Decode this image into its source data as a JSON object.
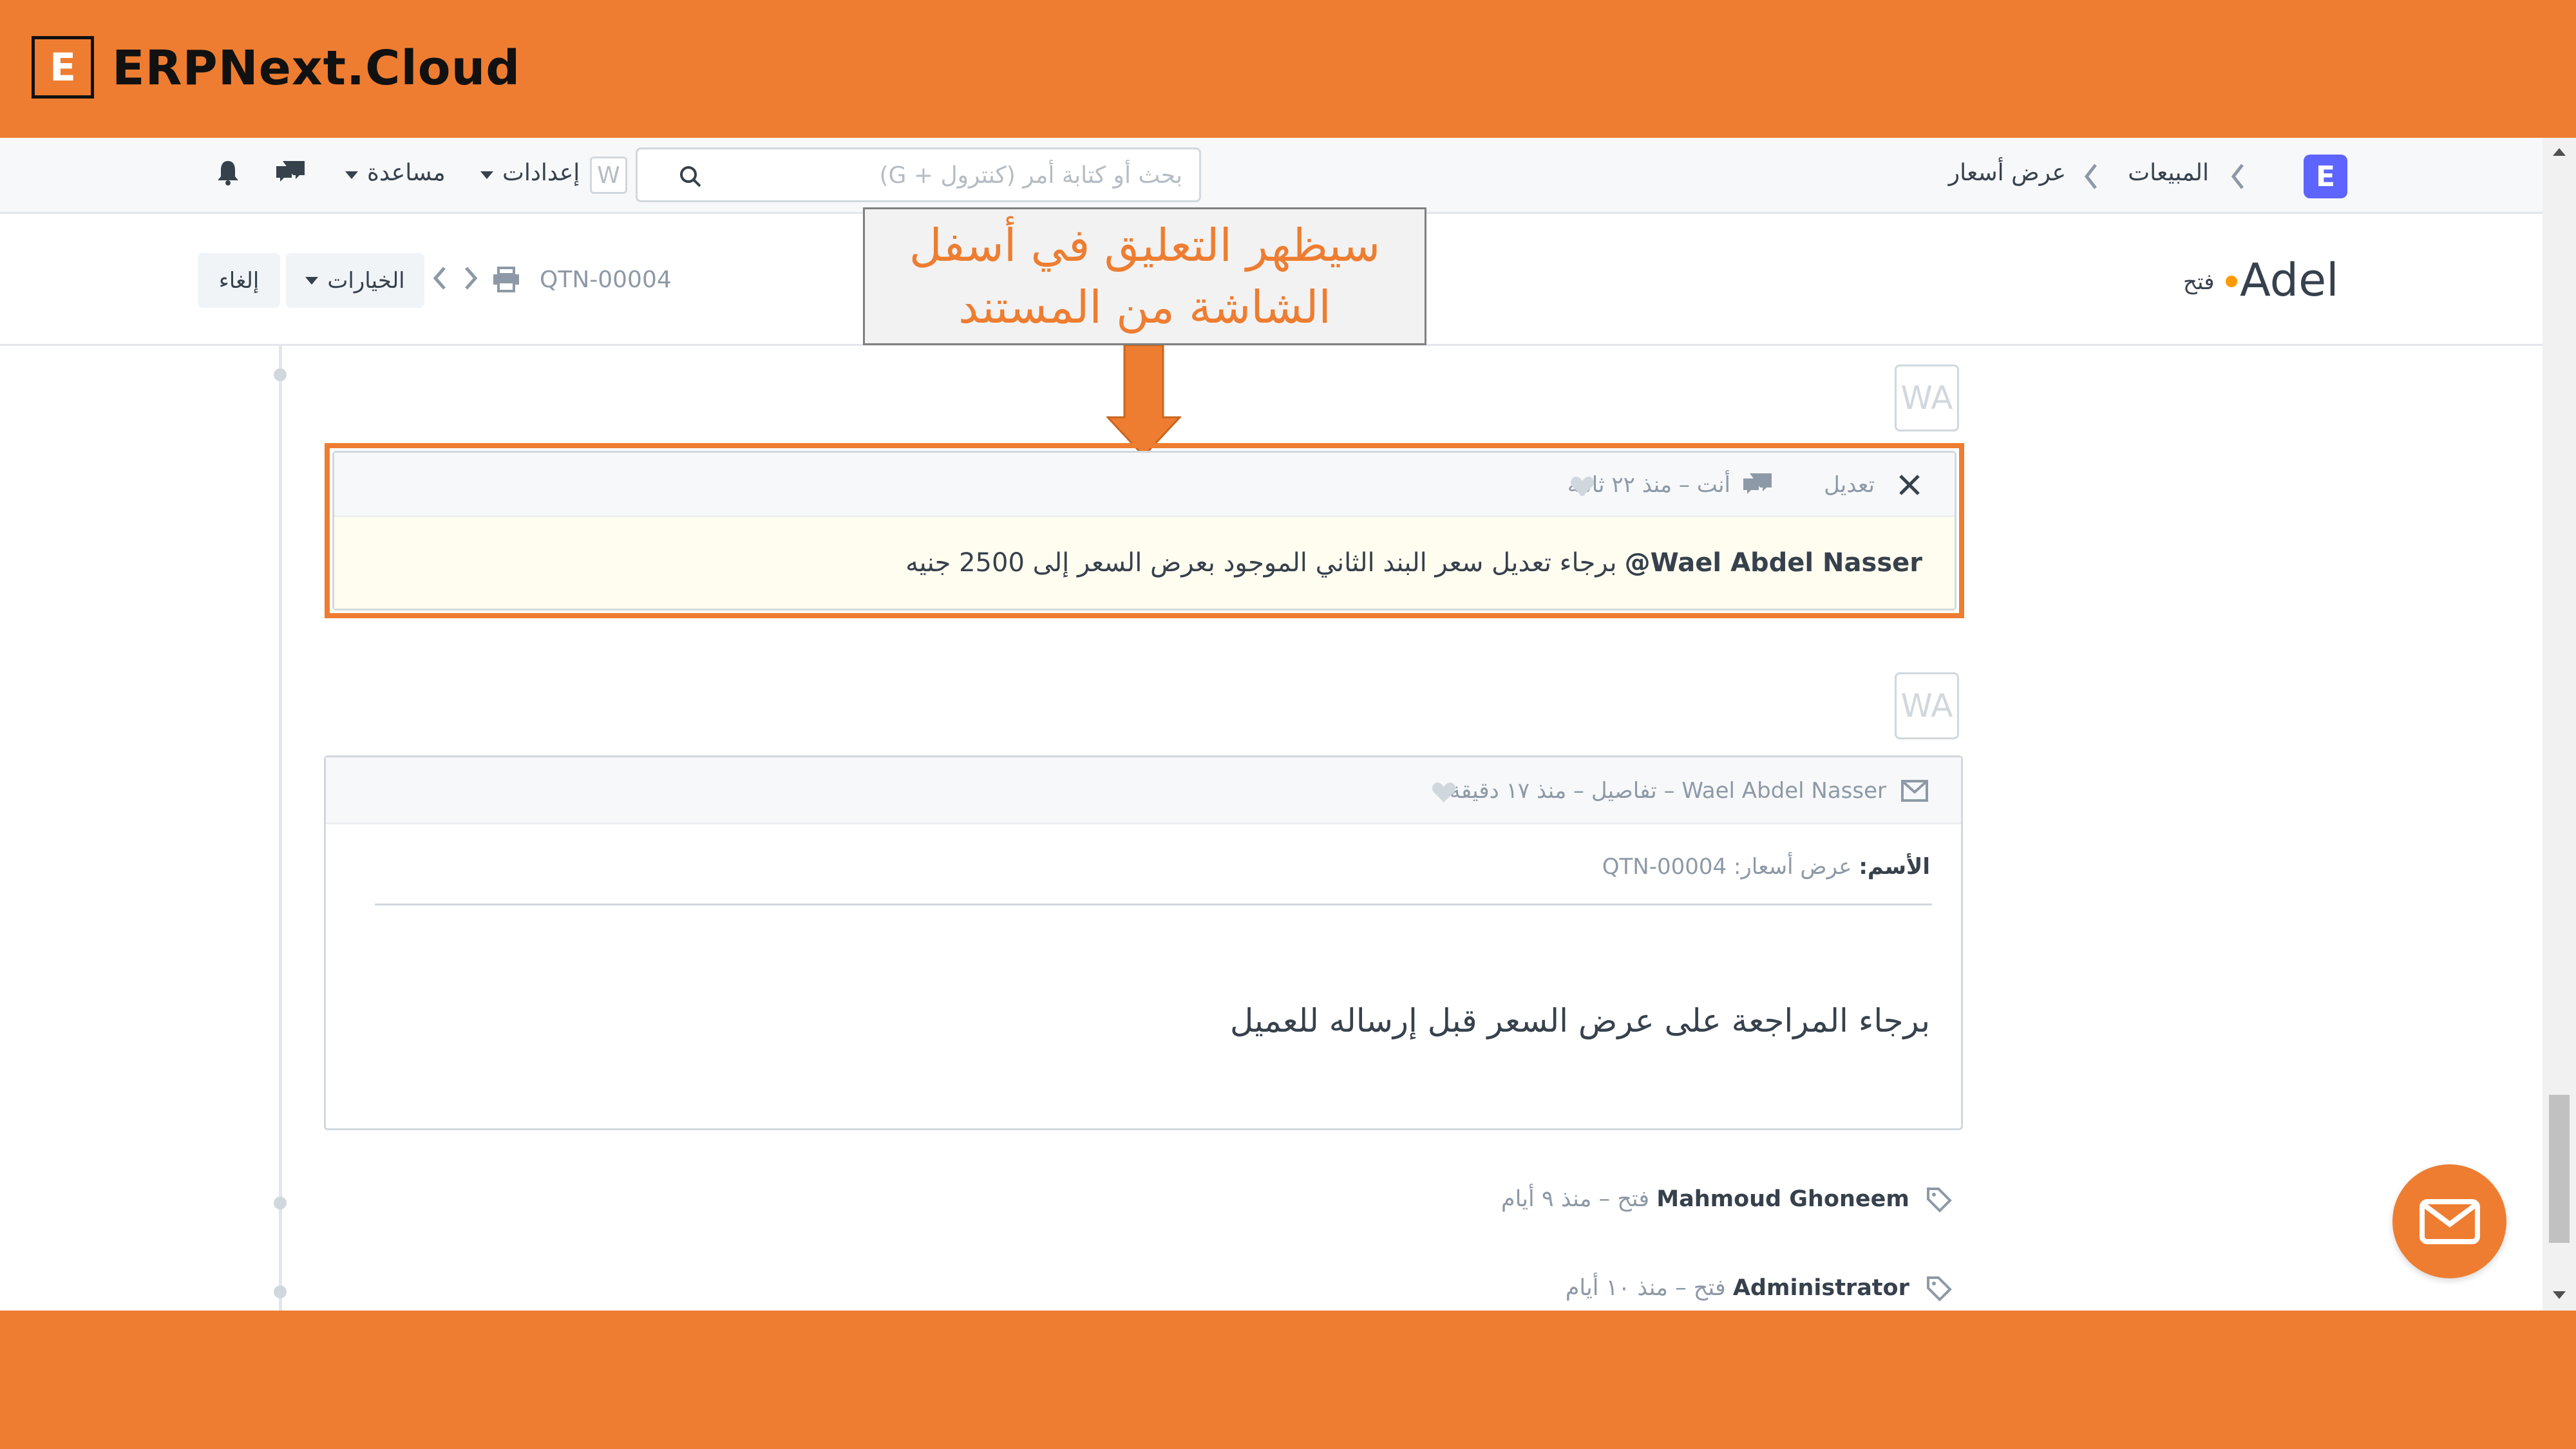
{
  "brand": {
    "logo_letter": "E",
    "name": "ERPNext.Cloud"
  },
  "navbar": {
    "app_badge": "E",
    "breadcrumb": [
      "المبيعات",
      "عرض أسعار"
    ],
    "search_placeholder": "بحث أو كتابة أمر (كنترول + G)",
    "settings_label": "إعدادات",
    "settings_badge": "W",
    "help_label": "مساعدة"
  },
  "page": {
    "title": "Adel",
    "status": "فتح",
    "doc_id": "QTN-00004",
    "options_label": "الخيارات",
    "cancel_label": "إلغاء"
  },
  "annotation": {
    "line1": "سيظهر التعليق في أسفل",
    "line2": "الشاشة من المستند"
  },
  "timeline": {
    "comment": {
      "avatar": "WA",
      "edit_label": "تعديل",
      "meta": "أنت – منذ ٢٢ ثانية",
      "mention": "@Wael Abdel Nasser",
      "body": "برجاء تعديل سعر البند الثاني الموجود بعرض السعر إلى 2500 جنيه"
    },
    "email": {
      "avatar": "WA",
      "meta": "Wael Abdel Nasser – تفاصيل – منذ ١٧ دقيقة",
      "subject_label": "الأسم:",
      "subject_value": "عرض أسعار: QTN-00004",
      "body": "برجاء المراجعة على عرض السعر قبل إرساله للعميل"
    },
    "activity": [
      {
        "user": "Mahmoud Ghoneem",
        "text": "فتح – منذ ٩ أيام"
      },
      {
        "user": "Administrator",
        "text": "فتح – منذ ١٠ أيام"
      }
    ]
  },
  "colors": {
    "accent": "#ee7d31",
    "app_badge": "#5e64ff"
  }
}
